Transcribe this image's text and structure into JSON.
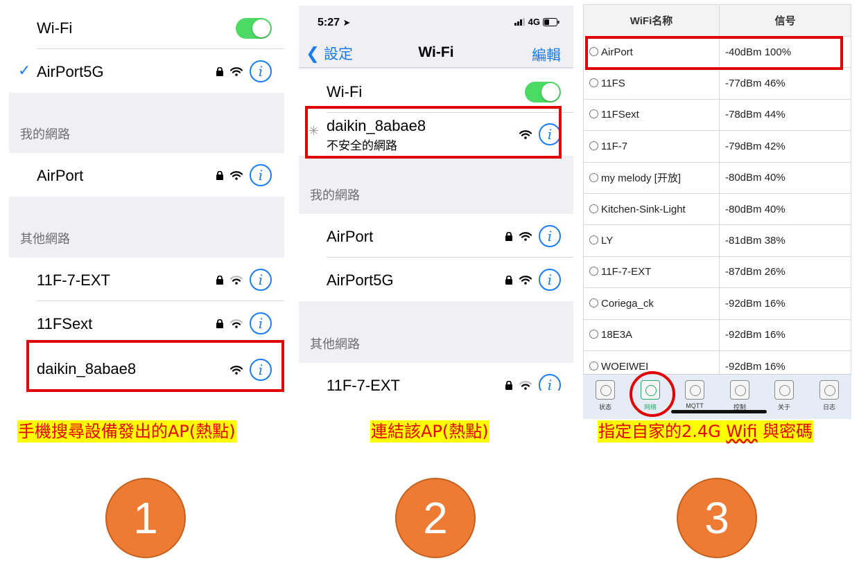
{
  "panel1": {
    "wifi_label": "Wi-Fi",
    "connected_network": "AirPort5G",
    "my_networks_header": "我的網路",
    "my_networks": [
      "AirPort"
    ],
    "other_networks_header": "其他網路",
    "other_networks": [
      "11F-7-EXT",
      "11FSext",
      "daikin_8abae8"
    ]
  },
  "panel2": {
    "time": "5:27",
    "carrier": "4G",
    "back_label": "設定",
    "title": "Wi-Fi",
    "edit_label": "編輯",
    "wifi_label": "Wi-Fi",
    "joining_network": "daikin_8abae8",
    "joining_subtitle": "不安全的網路",
    "my_networks_header": "我的網路",
    "my_networks": [
      "AirPort",
      "AirPort5G"
    ],
    "other_networks_header": "其他網路",
    "other_networks": [
      "11F-7-EXT"
    ]
  },
  "panel3": {
    "header_name": "WiFi名称",
    "header_signal": "信号",
    "rows": [
      {
        "name": "AirPort",
        "signal": "-40dBm 100%"
      },
      {
        "name": "11FS",
        "signal": "-77dBm 46%"
      },
      {
        "name": "11FSext",
        "signal": "-78dBm 44%"
      },
      {
        "name": "11F-7",
        "signal": "-79dBm 42%"
      },
      {
        "name": "my melody [开放]",
        "signal": "-80dBm 40%"
      },
      {
        "name": "Kitchen-Sink-Light",
        "signal": "-80dBm 40%"
      },
      {
        "name": "LY",
        "signal": "-81dBm 38%"
      },
      {
        "name": "11F-7-EXT",
        "signal": "-87dBm 26%"
      },
      {
        "name": "Coriega_ck",
        "signal": "-92dBm 16%"
      },
      {
        "name": "18E3A",
        "signal": "-92dBm 16%"
      },
      {
        "name": "WOEIWEI",
        "signal": "-92dBm 16%"
      }
    ],
    "tabs": [
      "状态",
      "网络",
      "MQTT",
      "控制",
      "关于",
      "日志"
    ],
    "active_tab": "网络"
  },
  "captions": {
    "step1": "手機搜尋設備發出的AP(熱點)",
    "step2": "連結該AP(熱點)",
    "step3_prefix": "指定自家的2.4G ",
    "step3_wifi": "Wifi",
    "step3_suffix": " 與密碼"
  },
  "steps": [
    "1",
    "2",
    "3"
  ],
  "colors": {
    "ios_blue": "#1a7cf5",
    "toggle_green": "#4cd964",
    "highlight_red": "#e00000",
    "caption_yellow": "#ffff00",
    "step_orange": "#ee7b33"
  }
}
